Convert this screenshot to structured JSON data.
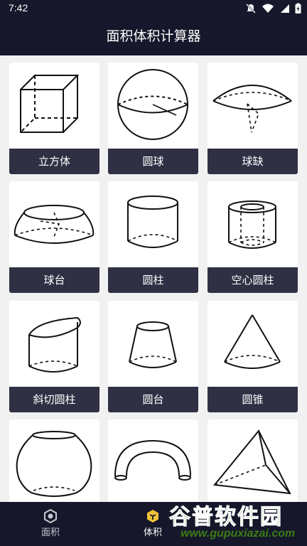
{
  "status_bar": {
    "time": "7:42",
    "icons": [
      "mute-icon",
      "wifi-icon",
      "signal-icon",
      "battery-charging-icon"
    ]
  },
  "app_bar": {
    "title": "面积体积计算器"
  },
  "shapes": [
    {
      "label": "立方体",
      "icon": "cube-icon"
    },
    {
      "label": "圆球",
      "icon": "sphere-icon"
    },
    {
      "label": "球缺",
      "icon": "spherical-cap-icon"
    },
    {
      "label": "球台",
      "icon": "spherical-segment-icon"
    },
    {
      "label": "圆柱",
      "icon": "cylinder-icon"
    },
    {
      "label": "空心圆柱",
      "icon": "hollow-cylinder-icon"
    },
    {
      "label": "斜切圆柱",
      "icon": "oblique-cut-cylinder-icon"
    },
    {
      "label": "圆台",
      "icon": "frustum-icon"
    },
    {
      "label": "圆锥",
      "icon": "cone-icon"
    },
    {
      "label": "",
      "icon": "barrel-icon"
    },
    {
      "label": "",
      "icon": "torus-icon"
    },
    {
      "label": "",
      "icon": "tetrahedron-icon"
    }
  ],
  "bottom_nav": {
    "items": [
      {
        "label": "面积",
        "icon": "hexagon-icon",
        "active": false
      },
      {
        "label": "体积",
        "icon": "cube-icon",
        "active": true
      }
    ]
  },
  "watermark": {
    "text": "谷普软件园",
    "url": "www.gupuxiazai.com"
  },
  "colors": {
    "bar": "#16172a",
    "label_bg": "#2f3044",
    "active": "#f0c23a"
  }
}
